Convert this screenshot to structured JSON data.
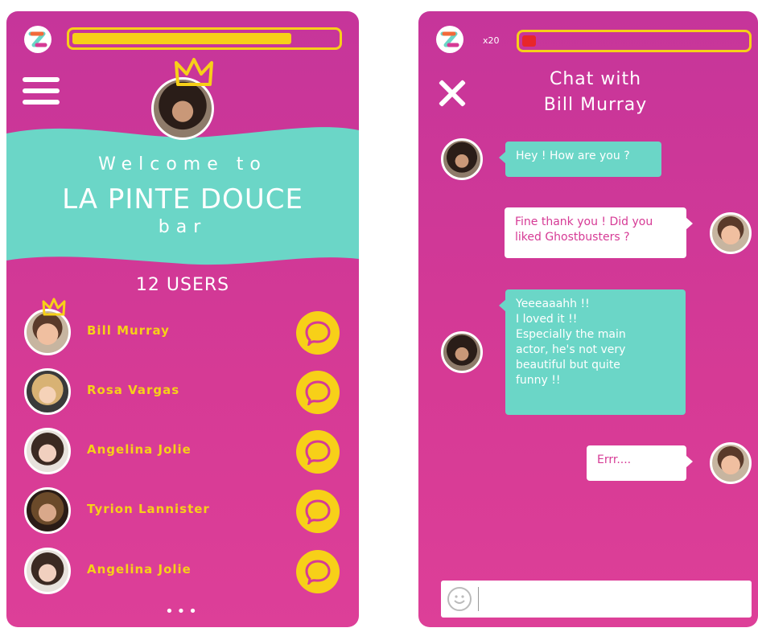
{
  "colors": {
    "background_pink": "#d63a95",
    "accent_teal": "#6bd6c7",
    "accent_yellow": "#f7d018",
    "meter_red": "#e8262a"
  },
  "left_screen": {
    "meter_level": 0.83,
    "banner": {
      "welcome": "Welcome to",
      "bar_name": "LA PINTE DOUCE",
      "bar_type": "bar"
    },
    "users_count": "12 USERS",
    "users": [
      {
        "name": "Bill Murray",
        "crowned": true
      },
      {
        "name": "Rosa Vargas",
        "crowned": false
      },
      {
        "name": "Angelina Jolie",
        "crowned": false
      },
      {
        "name": "Tyrion Lannister",
        "crowned": false
      },
      {
        "name": "Angelina Jolie",
        "crowned": false
      }
    ],
    "more": "•••"
  },
  "right_screen": {
    "multiplier": "x20",
    "meter_level": 0.06,
    "title_line1": "Chat with",
    "title_line2": "Bill Murray",
    "messages": [
      {
        "from": "them",
        "lines": [
          "Hey ! How are you ?"
        ]
      },
      {
        "from": "me",
        "lines": [
          "Fine thank you ! Did you",
          "liked Ghostbusters ?"
        ]
      },
      {
        "from": "them",
        "lines": [
          "Yeeeaaahh !!",
          "I loved it !!",
          "Especially the main",
          "actor, he's not very",
          "beautiful but quite",
          "funny !!"
        ]
      },
      {
        "from": "me",
        "lines": [
          "Errr...."
        ]
      }
    ],
    "composer_placeholder": ""
  }
}
